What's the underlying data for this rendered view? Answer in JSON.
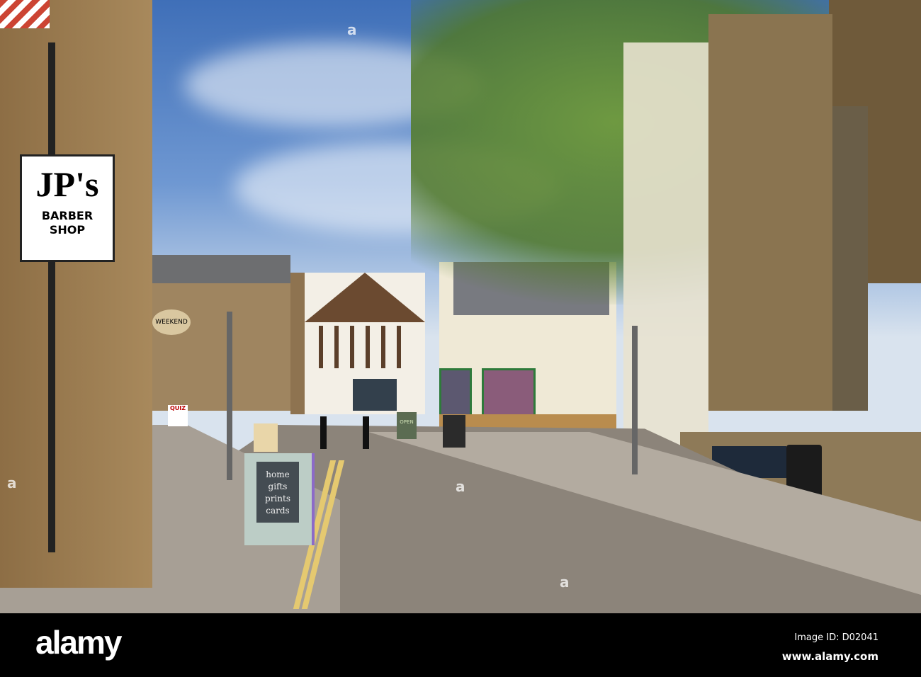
{
  "signs": {
    "barber_name": "JP's",
    "barber_sub": "BARBER SHOP",
    "gallery_board": [
      "home",
      "gifts",
      "prints",
      "cards"
    ],
    "open_board": "OPEN",
    "weekend": "WEEKEND",
    "quiz": "QUIZ"
  },
  "watermark": {
    "logo": "alamy",
    "image_id": "Image ID: D02041",
    "site": "www.alamy.com",
    "overlay_mark": "a"
  },
  "colors": {
    "sky": "#5a86c8",
    "stone": "#a88656",
    "road": "#8a8278",
    "pavement": "#a59d94",
    "tree": "#6f9a3a"
  }
}
